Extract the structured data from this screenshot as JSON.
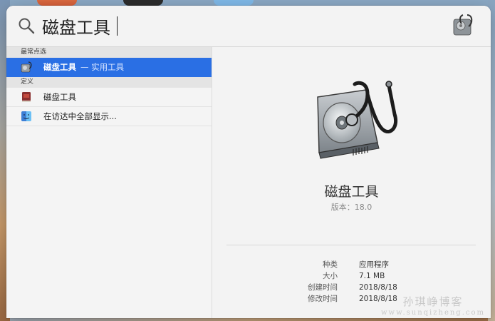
{
  "search": {
    "query": "磁盘工具"
  },
  "sections": {
    "top_hit": "最常点选",
    "definition": "定义"
  },
  "results": {
    "top": {
      "label": "磁盘工具",
      "sub": "— 实用工具"
    },
    "dict": {
      "label": "磁盘工具"
    },
    "finder": {
      "label": "在访达中全部显示..."
    }
  },
  "preview": {
    "name": "磁盘工具",
    "version": "版本：18.0",
    "meta": [
      {
        "key": "种类",
        "value": "应用程序"
      },
      {
        "key": "大小",
        "value": "7.1 MB"
      },
      {
        "key": "创建时间",
        "value": "2018/8/18"
      },
      {
        "key": "修改时间",
        "value": "2018/8/18"
      }
    ]
  },
  "watermark": {
    "title": "孙琪峥博客",
    "url": "www.sunqizheng.com"
  },
  "colors": {
    "selection": "#2a6fe4",
    "panel": "#f3f3f3"
  },
  "icons": [
    "search-icon",
    "disk-utility-icon",
    "dictionary-icon",
    "finder-icon"
  ]
}
